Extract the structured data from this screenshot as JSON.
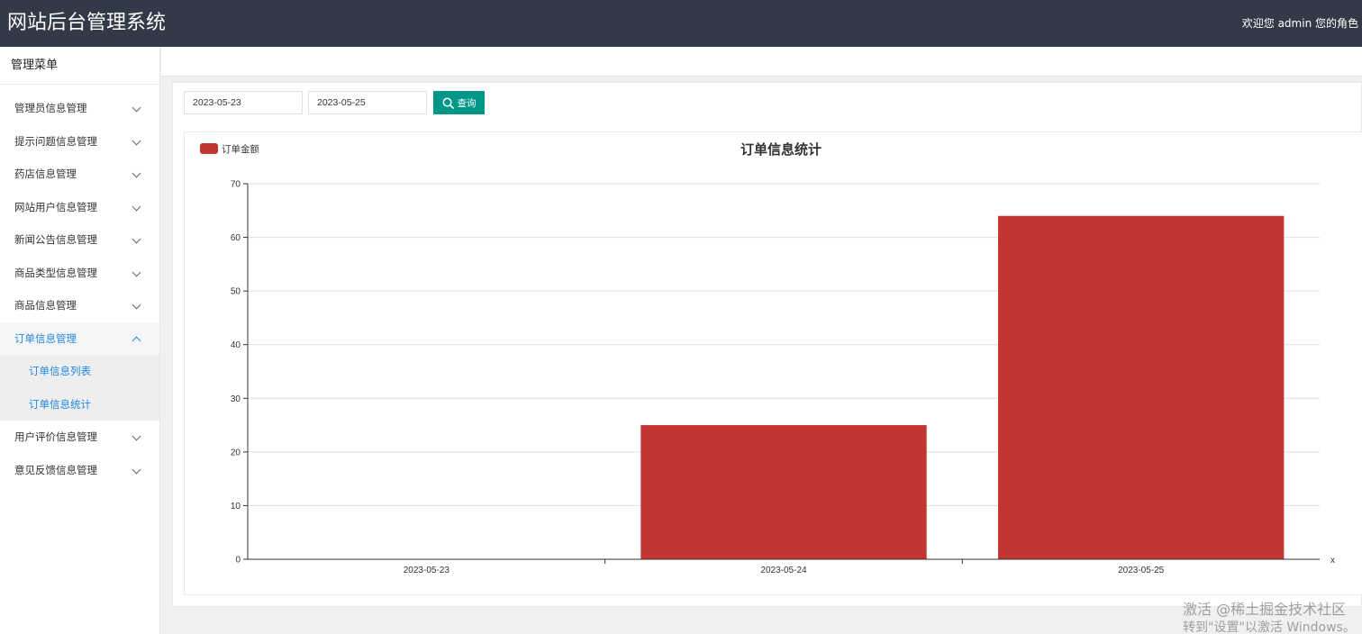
{
  "header": {
    "title": "网站后台管理系统",
    "welcome": "欢迎您 admin 您的角色"
  },
  "sidebar": {
    "menu_title": "管理菜单",
    "items": [
      {
        "label": "管理员信息管理"
      },
      {
        "label": "提示问题信息管理"
      },
      {
        "label": "药店信息管理"
      },
      {
        "label": "网站用户信息管理"
      },
      {
        "label": "新闻公告信息管理"
      },
      {
        "label": "商品类型信息管理"
      },
      {
        "label": "商品信息管理"
      },
      {
        "label": "订单信息管理",
        "active": true,
        "children": [
          {
            "label": "订单信息列表"
          },
          {
            "label": "订单信息统计"
          }
        ]
      },
      {
        "label": "用户评价信息管理"
      },
      {
        "label": "意见反馈信息管理"
      }
    ]
  },
  "filters": {
    "start_date": "2023-05-23",
    "end_date": "2023-05-25",
    "search_label": "查询"
  },
  "chart_data": {
    "type": "bar",
    "title": "订单信息统计",
    "categories": [
      "2023-05-23",
      "2023-05-24",
      "2023-05-25"
    ],
    "series": [
      {
        "name": "订单金额",
        "values": [
          0,
          25,
          64
        ],
        "color": "#c23531"
      }
    ],
    "ylim": [
      0,
      70
    ],
    "yticks": [
      0,
      10,
      20,
      30,
      40,
      50,
      60,
      70
    ],
    "xlabel": "x",
    "grid": true,
    "legend": "top-left"
  },
  "watermark": {
    "line1": "激活 @稀土掘金技术社区",
    "line2": "转到\"设置\"以激活 Windows。"
  }
}
